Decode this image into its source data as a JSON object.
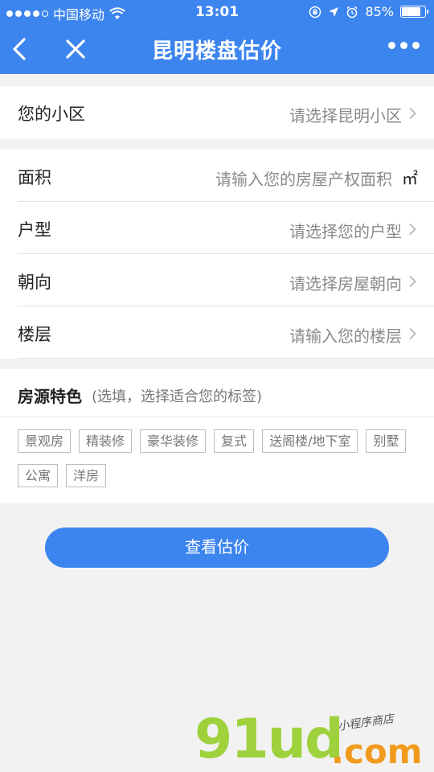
{
  "statusbar": {
    "carrier": "中国移动",
    "time": "13:01",
    "battery_text": "85%",
    "battery_level": 0.85
  },
  "navbar": {
    "title": "昆明楼盘估价"
  },
  "community": {
    "label": "您的小区",
    "placeholder": "请选择昆明小区"
  },
  "details": [
    {
      "label": "面积",
      "placeholder": "请输入您的房屋产权面积",
      "unit": "㎡"
    },
    {
      "label": "户型",
      "placeholder": "请选择您的户型"
    },
    {
      "label": "朝向",
      "placeholder": "请选择房屋朝向"
    },
    {
      "label": "楼层",
      "placeholder": "请输入您的楼层"
    }
  ],
  "features": {
    "title": "房源特色",
    "hint": "(选填，选择适合您的标签)",
    "tags": [
      "景观房",
      "精装修",
      "豪华装修",
      "复式",
      "送阁楼/地下室",
      "别墅",
      "公寓",
      "洋房"
    ]
  },
  "submit_label": "查看估价",
  "watermark": {
    "main": "91ud",
    "suffix": ".com",
    "tagline": "小程序商店"
  },
  "colors": {
    "primary": "#3d85ee",
    "background": "#f2f2f2",
    "placeholder": "#8a8a8a"
  }
}
